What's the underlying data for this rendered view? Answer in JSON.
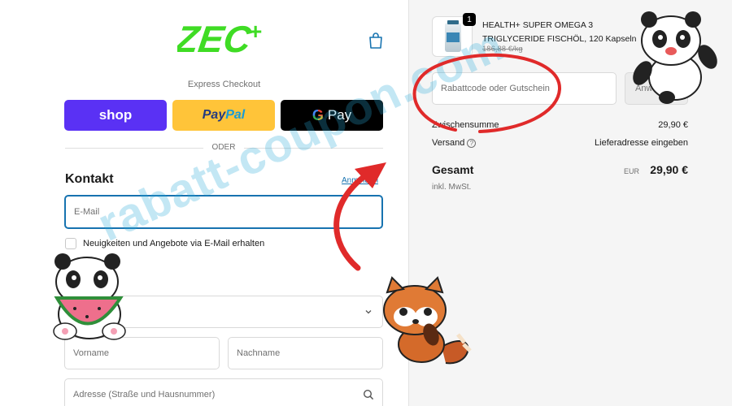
{
  "header": {
    "logo_text": "ZEC+",
    "cart_icon": "shopping-bag-icon"
  },
  "express": {
    "label": "Express Checkout",
    "shop_label": "shop",
    "paypal_part1": "Pay",
    "paypal_part2": "Pal",
    "gpay_g": "G",
    "gpay_label": "Pay",
    "or_label": "ODER"
  },
  "contact": {
    "title": "Kontakt",
    "login_link": "Anmelden",
    "email_placeholder": "E-Mail",
    "newsletter_label": "Neuigkeiten und Angebote via E-Mail erhalten"
  },
  "delivery": {
    "first_name_placeholder": "Vorname",
    "last_name_placeholder": "Nachname",
    "address_placeholder": "Adresse (Straße und Hausnummer)"
  },
  "summary": {
    "quantity": "1",
    "product_line1": "HEALTH+ SUPER OMEGA 3",
    "product_line2": "TRIGLYCERIDE FISCHÖL, 120 Kapseln",
    "unit_price": "186,88 €/kg",
    "discount_placeholder": "Rabattcode oder Gutschein",
    "apply_label": "Anwenden",
    "subtotal_label": "Zwischensumme",
    "subtotal_value": "29,90 €",
    "shipping_label": "Versand",
    "shipping_value": "Lieferadresse eingeben",
    "total_label": "Gesamt",
    "total_currency": "EUR",
    "total_value": "29,90 €",
    "tax_note": "inkl. MwSt."
  },
  "overlay": {
    "watermark": "rabatt-coupon.com"
  },
  "colors": {
    "brand_green": "#3fdc24",
    "shop_purple": "#5a31f4",
    "paypal_yellow": "#ffc439",
    "focus_blue": "#1773b0",
    "annotation_red": "#e02a2a"
  }
}
